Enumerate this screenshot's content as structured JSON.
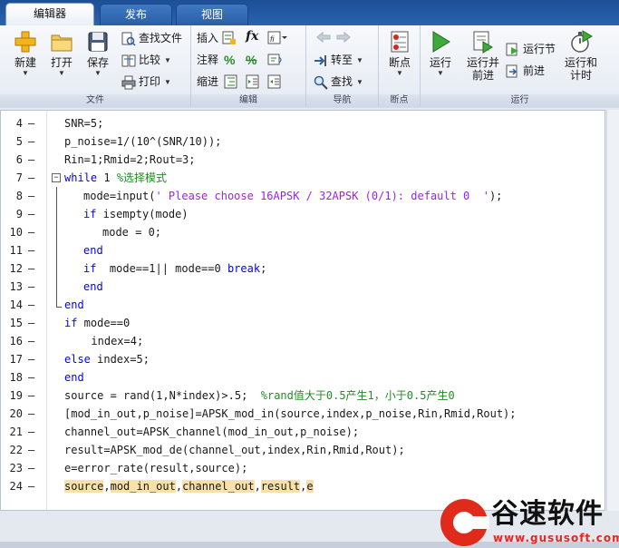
{
  "tabs": [
    {
      "label": "编辑器",
      "active": true
    },
    {
      "label": "发布",
      "active": false
    },
    {
      "label": "视图",
      "active": false
    }
  ],
  "ribbon": {
    "file_group": {
      "label": "文件",
      "new": "新建",
      "open": "打开",
      "save": "保存",
      "find_files": "查找文件",
      "compare": "比较",
      "print": "打印"
    },
    "edit_group": {
      "label": "编辑",
      "insert": "插入",
      "comment": "注释",
      "indent": "缩进",
      "fx": "fx"
    },
    "nav_group": {
      "label": "导航",
      "goto": "转至",
      "find": "查找"
    },
    "breakpoint_group": {
      "label": "断点",
      "breakpoints": "断点"
    },
    "run_group": {
      "label": "运行",
      "run": "运行",
      "run_advance_1": "运行并",
      "run_advance_2": "前进",
      "run_section": "运行节",
      "advance": "前进",
      "run_time_1": "运行和",
      "run_time_2": "计时"
    }
  },
  "code_lines": [
    {
      "num": "4",
      "marker": "—",
      "indent": 0,
      "parts": [
        {
          "t": "SNR=5;",
          "c": ""
        }
      ]
    },
    {
      "num": "5",
      "marker": "—",
      "indent": 0,
      "parts": [
        {
          "t": "p_noise=1/(10^(SNR/10));",
          "c": ""
        }
      ]
    },
    {
      "num": "6",
      "marker": "—",
      "indent": 0,
      "parts": [
        {
          "t": "Rin=1;Rmid=2;Rout=3;",
          "c": ""
        }
      ]
    },
    {
      "num": "7",
      "marker": "—",
      "indent": 0,
      "parts": [
        {
          "t": "while",
          "c": "kw"
        },
        {
          "t": " 1 ",
          "c": ""
        },
        {
          "t": "%选择模式",
          "c": "cmt"
        }
      ]
    },
    {
      "num": "8",
      "marker": "—",
      "indent": 1,
      "parts": [
        {
          "t": "mode=input(",
          "c": ""
        },
        {
          "t": "' Please choose 16APSK / 32APSK (0/1): default 0  '",
          "c": "str"
        },
        {
          "t": ");",
          "c": ""
        }
      ]
    },
    {
      "num": "9",
      "marker": "—",
      "indent": 1,
      "parts": [
        {
          "t": "if",
          "c": "kw"
        },
        {
          "t": " isempty(mode)",
          "c": ""
        }
      ]
    },
    {
      "num": "10",
      "marker": "—",
      "indent": 2,
      "parts": [
        {
          "t": "mode = 0;",
          "c": ""
        }
      ]
    },
    {
      "num": "11",
      "marker": "—",
      "indent": 1,
      "parts": [
        {
          "t": "end",
          "c": "kw"
        }
      ]
    },
    {
      "num": "12",
      "marker": "—",
      "indent": 1,
      "parts": [
        {
          "t": "if",
          "c": "kw"
        },
        {
          "t": "  mode==1|| mode==0 ",
          "c": ""
        },
        {
          "t": "break",
          "c": "kw"
        },
        {
          "t": ";",
          "c": ""
        }
      ]
    },
    {
      "num": "13",
      "marker": "—",
      "indent": 1,
      "parts": [
        {
          "t": "end",
          "c": "kw"
        }
      ]
    },
    {
      "num": "14",
      "marker": "—",
      "indent": 0,
      "parts": [
        {
          "t": "end",
          "c": "kw"
        }
      ]
    },
    {
      "num": "15",
      "marker": "—",
      "indent": 0,
      "parts": [
        {
          "t": "if",
          "c": "kw"
        },
        {
          "t": " mode==0",
          "c": ""
        }
      ]
    },
    {
      "num": "16",
      "marker": "—",
      "indent": 1.4,
      "parts": [
        {
          "t": "index=4;",
          "c": ""
        }
      ]
    },
    {
      "num": "17",
      "marker": "—",
      "indent": 0,
      "parts": [
        {
          "t": "else",
          "c": "kw"
        },
        {
          "t": " index=5;",
          "c": ""
        }
      ]
    },
    {
      "num": "18",
      "marker": "—",
      "indent": 0,
      "parts": [
        {
          "t": "end",
          "c": "kw"
        }
      ]
    },
    {
      "num": "19",
      "marker": "—",
      "indent": 0,
      "parts": [
        {
          "t": "source = rand(1,N*index)>.5;  ",
          "c": ""
        },
        {
          "t": "%rand值大于0.5产生1，小于0.5产生0",
          "c": "cmt"
        }
      ]
    },
    {
      "num": "20",
      "marker": "—",
      "indent": 0,
      "parts": [
        {
          "t": "[mod_in_out,p_noise]=APSK_mod_in(source,index,p_noise,Rin,Rmid,Rout);",
          "c": ""
        }
      ]
    },
    {
      "num": "21",
      "marker": "—",
      "indent": 0,
      "parts": [
        {
          "t": "channel_out=APSK_channel(mod_in_out,p_noise);",
          "c": ""
        }
      ]
    },
    {
      "num": "22",
      "marker": "—",
      "indent": 0,
      "parts": [
        {
          "t": "result=APSK_mod_de(channel_out,index,Rin,Rmid,Rout);",
          "c": ""
        }
      ]
    },
    {
      "num": "23",
      "marker": "—",
      "indent": 0,
      "parts": [
        {
          "t": "e=error_rate(result,source);",
          "c": ""
        }
      ]
    },
    {
      "num": "24",
      "marker": "—",
      "indent": 0,
      "parts": [
        {
          "t": "source",
          "c": "hl"
        },
        {
          "t": ",",
          "c": ""
        },
        {
          "t": "mod_in_out",
          "c": "hl"
        },
        {
          "t": ",",
          "c": ""
        },
        {
          "t": "channel_out",
          "c": "hl"
        },
        {
          "t": ",",
          "c": ""
        },
        {
          "t": "result",
          "c": "hl"
        },
        {
          "t": ",",
          "c": ""
        },
        {
          "t": "e",
          "c": "hl"
        }
      ]
    }
  ],
  "fold_marker": "−",
  "watermark": {
    "title": "谷速软件",
    "url": "www.gususoft.com"
  },
  "colors": {
    "keyword": "#0000ff",
    "string": "#a020f0",
    "comment": "#228b22",
    "highlight": "#f7e0a9",
    "brand_red": "#e02a1b"
  }
}
